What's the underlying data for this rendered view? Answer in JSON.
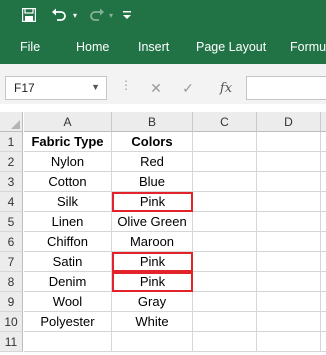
{
  "quick_access": {
    "save_icon": "save-icon",
    "undo_icon": "undo-icon",
    "redo_icon": "redo-icon",
    "more_icon": "customize-toolbar-icon"
  },
  "ribbon": {
    "tabs": [
      {
        "label": "File"
      },
      {
        "label": "Home"
      },
      {
        "label": "Insert"
      },
      {
        "label": "Page Layout"
      },
      {
        "label": "Formulas"
      }
    ],
    "background": "#217346"
  },
  "formula_bar": {
    "name_box": "F17",
    "formula": ""
  },
  "sheet": {
    "columns": [
      "A",
      "B",
      "C",
      "D"
    ],
    "rows": [
      {
        "num": "1",
        "a": "Fabric Type",
        "b": "Colors",
        "header": true
      },
      {
        "num": "2",
        "a": "Nylon",
        "b": "Red"
      },
      {
        "num": "3",
        "a": "Cotton",
        "b": "Blue"
      },
      {
        "num": "4",
        "a": "Silk",
        "b": "Pink",
        "marked": true
      },
      {
        "num": "5",
        "a": "Linen",
        "b": "Olive Green"
      },
      {
        "num": "6",
        "a": "Chiffon",
        "b": "Maroon"
      },
      {
        "num": "7",
        "a": "Satin",
        "b": "Pink",
        "marked": true
      },
      {
        "num": "8",
        "a": "Denim",
        "b": "Pink",
        "marked": true
      },
      {
        "num": "9",
        "a": "Wool",
        "b": "Gray"
      },
      {
        "num": "10",
        "a": "Polyester",
        "b": "White"
      },
      {
        "num": "11",
        "a": "",
        "b": ""
      }
    ],
    "highlight_color": "#e2232a"
  }
}
